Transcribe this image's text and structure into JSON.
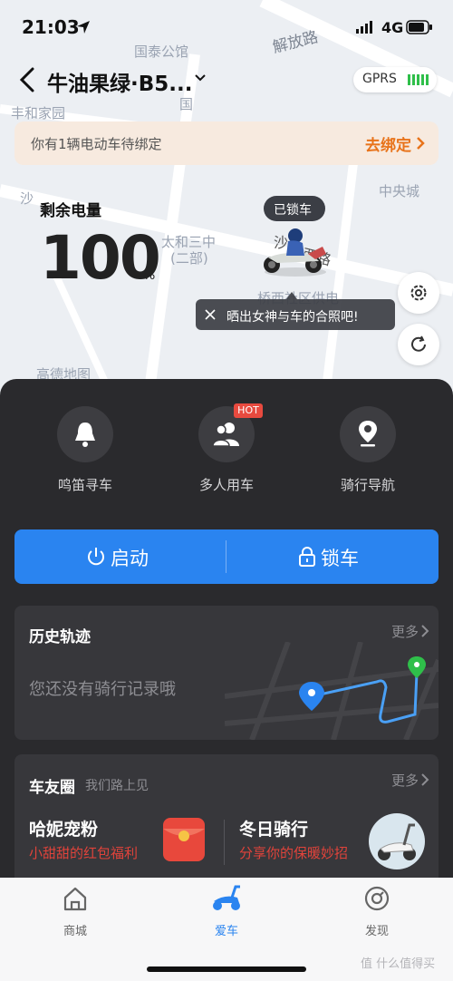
{
  "status_bar": {
    "time": "21:03",
    "network": "4G"
  },
  "map": {
    "labels": [
      "国泰公馆",
      "解放路",
      "国",
      "丰和家园",
      "沙",
      "中央城",
      "太和三中",
      "(二部)",
      "沙",
      "西路",
      "桥西社区供电",
      "高德地图"
    ]
  },
  "header": {
    "title": "牛油果绿·B5...",
    "connection": "GPRS"
  },
  "banner": {
    "text": "你有1辆电动车待绑定",
    "link": "去绑定"
  },
  "battery": {
    "label": "剩余电量",
    "value": "100",
    "unit": "%"
  },
  "vehicle": {
    "lock_status": "已锁车"
  },
  "photo_tip": {
    "text": "晒出女神与车的合照吧!"
  },
  "actions": [
    {
      "label": "鸣笛寻车",
      "icon": "bell-icon"
    },
    {
      "label": "多人用车",
      "icon": "multi-user-icon",
      "badge": "HOT"
    },
    {
      "label": "骑行导航",
      "icon": "location-pin-icon"
    }
  ],
  "controls": {
    "start": "启动",
    "lock": "锁车"
  },
  "history": {
    "title": "历史轨迹",
    "more": "更多",
    "empty": "您还没有骑行记录哦"
  },
  "friends": {
    "title": "车友圈",
    "subtitle": "我们路上见",
    "more": "更多",
    "promos": [
      {
        "title": "哈妮宠粉",
        "subtitle": "小甜甜的红包福利"
      },
      {
        "title": "冬日骑行",
        "subtitle": "分享你的保暖妙招"
      }
    ]
  },
  "tabs": [
    {
      "label": "商城",
      "icon": "home-icon"
    },
    {
      "label": "爱车",
      "icon": "scooter-icon",
      "active": true
    },
    {
      "label": "发现",
      "icon": "discover-icon"
    }
  ],
  "watermark": "值 什么值得买",
  "colors": {
    "accent": "#2a84f0",
    "orange": "#e8731a",
    "hot": "#e84a3f",
    "panel": "#2a2a2d"
  }
}
